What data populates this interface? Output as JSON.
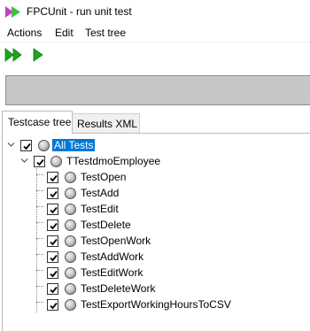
{
  "window": {
    "title": "FPCUnit - run unit test"
  },
  "menu": {
    "items": [
      "Actions",
      "Edit",
      "Test tree"
    ]
  },
  "tabs": [
    {
      "label": "Testcase tree",
      "active": true
    },
    {
      "label": "Results XML",
      "active": false
    }
  ],
  "tree": {
    "root": {
      "label": "All Tests",
      "checked": true,
      "selected": true
    },
    "suite": {
      "label": "TTestdmoEmployee",
      "checked": true
    },
    "tests": [
      {
        "label": "TestOpen",
        "checked": true
      },
      {
        "label": "TestAdd",
        "checked": true
      },
      {
        "label": "TestEdit",
        "checked": true
      },
      {
        "label": "TestDelete",
        "checked": true
      },
      {
        "label": "TestOpenWork",
        "checked": true
      },
      {
        "label": "TestAddWork",
        "checked": true
      },
      {
        "label": "TestEditWork",
        "checked": true
      },
      {
        "label": "TestDeleteWork",
        "checked": true
      },
      {
        "label": "TestExportWorkingHoursToCSV",
        "checked": true
      }
    ]
  },
  "icons": {
    "app": "fpcunit-app-icon",
    "run_all": "run-all-icon",
    "run_selected": "run-selected-icon",
    "expander": "chevron-down-icon",
    "test_status": "gray-sphere-icon"
  },
  "colors": {
    "run_icon": "#1ea51e",
    "progress_bar": "#c6c6c6",
    "selection": "#0078d7",
    "app_icon": "#c63fc6"
  }
}
